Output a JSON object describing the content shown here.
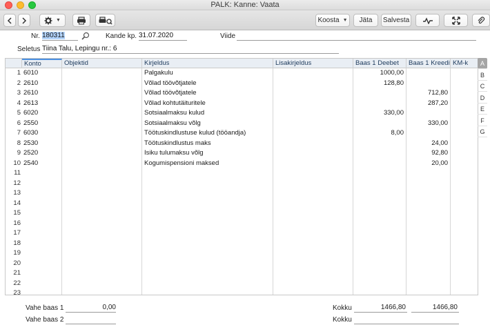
{
  "window": {
    "title": "PALK: Kanne: Vaata"
  },
  "toolbar": {
    "koosta_label": "Koosta",
    "jata_label": "Jäta",
    "salvesta_label": "Salvesta"
  },
  "header": {
    "nr_label": "Nr.",
    "nr_value": "180311",
    "kande_label": "Kande kp.",
    "kande_value": "31.07.2020",
    "viide_label": "Viide",
    "viide_value": "",
    "seletus_label": "Seletus",
    "seletus_value": "Tiina Talu,  Lepingu nr.: 6"
  },
  "table": {
    "columns": [
      "Konto",
      "Objektid",
      "Kirjeldus",
      "Lisakirjeldus",
      "Baas 1 Deebet",
      "Baas 1 Kreedit",
      "KM-k"
    ],
    "rows": [
      {
        "n": "1",
        "konto": "6010",
        "objektid": "",
        "kirjeldus": "Palgakulu",
        "lisa": "",
        "deebet": "1000,00",
        "kreedit": ""
      },
      {
        "n": "2",
        "konto": "2610",
        "objektid": "",
        "kirjeldus": "Võlad töövõtjatele",
        "lisa": "",
        "deebet": "128,80",
        "kreedit": ""
      },
      {
        "n": "3",
        "konto": "2610",
        "objektid": "",
        "kirjeldus": "Võlad töövõtjatele",
        "lisa": "",
        "deebet": "",
        "kreedit": "712,80"
      },
      {
        "n": "4",
        "konto": "2613",
        "objektid": "",
        "kirjeldus": "Võlad kohtutäituritele",
        "lisa": "",
        "deebet": "",
        "kreedit": "287,20"
      },
      {
        "n": "5",
        "konto": "6020",
        "objektid": "",
        "kirjeldus": "Sotsiaalmaksu kulud",
        "lisa": "",
        "deebet": "330,00",
        "kreedit": ""
      },
      {
        "n": "6",
        "konto": "2550",
        "objektid": "",
        "kirjeldus": "Sotsiaalmaksu võlg",
        "lisa": "",
        "deebet": "",
        "kreedit": "330,00"
      },
      {
        "n": "7",
        "konto": "6030",
        "objektid": "",
        "kirjeldus": "Töötuskindlustuse kulud (tööandja)",
        "lisa": "",
        "deebet": "8,00",
        "kreedit": ""
      },
      {
        "n": "8",
        "konto": "2530",
        "objektid": "",
        "kirjeldus": "Töötuskindlustus maks",
        "lisa": "",
        "deebet": "",
        "kreedit": "24,00"
      },
      {
        "n": "9",
        "konto": "2520",
        "objektid": "",
        "kirjeldus": "Isiku tulumaksu võlg",
        "lisa": "",
        "deebet": "",
        "kreedit": "92,80"
      },
      {
        "n": "10",
        "konto": "2540",
        "objektid": "",
        "kirjeldus": "Kogumispensioni maksed",
        "lisa": "",
        "deebet": "",
        "kreedit": "20,00"
      },
      {
        "n": "11"
      },
      {
        "n": "12"
      },
      {
        "n": "13"
      },
      {
        "n": "14"
      },
      {
        "n": "15"
      },
      {
        "n": "16"
      },
      {
        "n": "17"
      },
      {
        "n": "18"
      },
      {
        "n": "19"
      },
      {
        "n": "20"
      },
      {
        "n": "21"
      },
      {
        "n": "22"
      },
      {
        "n": "23"
      },
      {
        "n": "24"
      }
    ]
  },
  "side_tabs": [
    "A",
    "B",
    "C",
    "D",
    "E",
    "F",
    "G"
  ],
  "footer": {
    "vahe1_label": "Vahe baas 1",
    "vahe1_value": "0,00",
    "vahe2_label": "Vahe baas 2",
    "vahe2_value": "",
    "kokku1_label": "Kokku",
    "kokku1_deebet": "1466,80",
    "kokku1_kreedit": "1466,80",
    "kokku2_label": "Kokku"
  },
  "colors": {
    "accent": "#4a90e2",
    "selection": "#b3d4fc"
  }
}
